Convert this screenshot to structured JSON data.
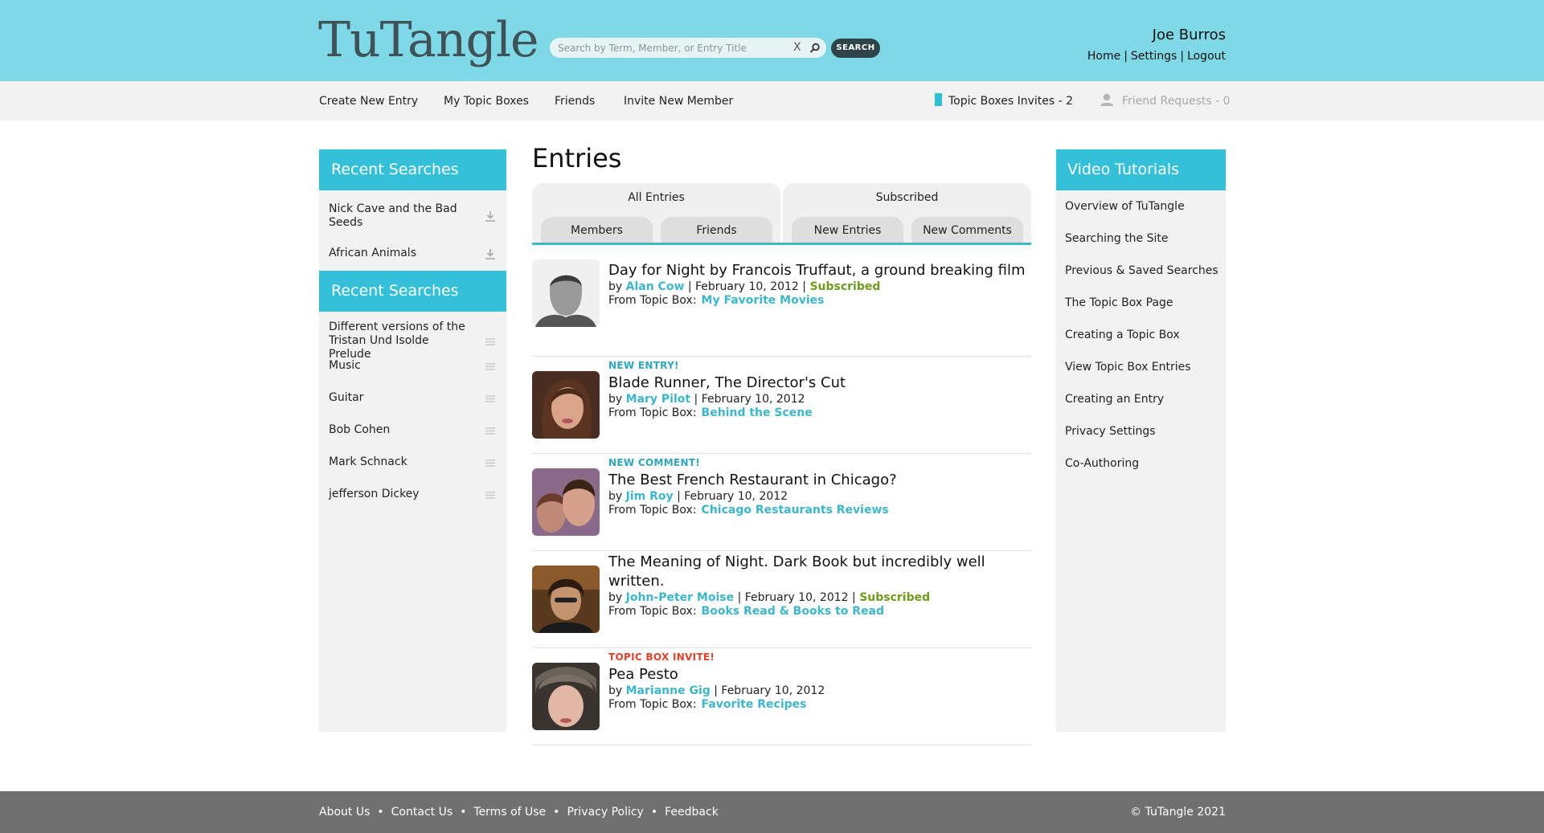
{
  "header": {
    "logo": "TuTangle",
    "search_placeholder": "Search by Term, Member, or Entry Title",
    "search_button": "SEARCH",
    "clear_glyph": "X",
    "user_name": "Joe Burros",
    "links": [
      "Home",
      "Settings",
      "Logout"
    ]
  },
  "nav": {
    "items": [
      "Create New Entry",
      "My Topic Boxes",
      "Friends",
      "Invite New Member"
    ],
    "topic_invites": "Topic Boxes Invites - 2",
    "friend_requests": "Friend Requests - 0"
  },
  "left_sidebar": {
    "section1_title": "Recent Searches",
    "section1_items": [
      "Nick Cave and the Bad Seeds",
      "African Animals"
    ],
    "section2_title": "Recent Searches",
    "section2_items": [
      "Different versions of the Tristan Und Isolde Prelude",
      "Music",
      "Guitar",
      "Bob Cohen",
      "Mark Schnack",
      "jefferson Dickey"
    ]
  },
  "main": {
    "title": "Entries",
    "tab_groups": [
      {
        "label": "All Entries",
        "tabs": [
          "Members",
          "Friends"
        ]
      },
      {
        "label": "Subscribed",
        "tabs": [
          "New Entries",
          "New Comments"
        ]
      }
    ],
    "entries": [
      {
        "badge": "",
        "title": "Day for Night by Francois Truffaut, a ground breaking film",
        "by": "by",
        "author": "Alan Cow",
        "date": "| February 10, 2012 |",
        "subscribed": "Subscribed",
        "from_label": "From Topic Box:",
        "topic": "My Favorite Movies"
      },
      {
        "badge": "NEW ENTRY!",
        "title": "Blade Runner, The Director's Cut",
        "by": "by",
        "author": "Mary Pilot",
        "date": "| February 10, 2012",
        "subscribed": "",
        "from_label": "From Topic Box:",
        "topic": "Behind the Scene"
      },
      {
        "badge": "NEW COMMENT!",
        "title": "The Best French Restaurant in Chicago?",
        "by": "by",
        "author": "Jim Roy",
        "date": "| February 10, 2012",
        "subscribed": "",
        "from_label": "From Topic Box:",
        "topic": "Chicago Restaurants Reviews"
      },
      {
        "badge": "",
        "title": "The Meaning of Night. Dark Book but incredibly well written.",
        "by": "by",
        "author": "John-Peter Moise",
        "date": "| February 10, 2012 |",
        "subscribed": "Subscribed",
        "from_label": "From Topic Box:",
        "topic": "Books Read & Books to Read"
      },
      {
        "badge": "TOPIC BOX INVITE!",
        "title": "Pea Pesto",
        "by": "by",
        "author": "Marianne Gig",
        "date": "| February 10, 2012",
        "subscribed": "",
        "from_label": "From Topic Box:",
        "topic": "Favorite Recipes"
      }
    ]
  },
  "right_sidebar": {
    "title": "Video Tutorials",
    "items": [
      "Overview of TuTangle",
      "Searching the Site",
      "Previous & Saved Searches",
      "The Topic Box Page",
      "Creating a Topic Box",
      "View Topic Box Entries",
      "Creating an Entry",
      "Privacy Settings",
      "Co-Authoring"
    ]
  },
  "footer": {
    "links": [
      "About Us",
      "Contact Us",
      "Terms of Use",
      "Privacy Policy",
      "Feedback"
    ],
    "separator": "•",
    "copyright": "© TuTangle 2021"
  },
  "colors": {
    "header_bg": "#7fd8e6",
    "accent": "#35c0d9",
    "subscribed": "#6f9b1f",
    "invite": "#e0412b",
    "footer_bg": "#707070"
  },
  "icons": [
    "search-icon",
    "download-icon",
    "drag-handle-icon",
    "book-icon",
    "person-icon"
  ]
}
